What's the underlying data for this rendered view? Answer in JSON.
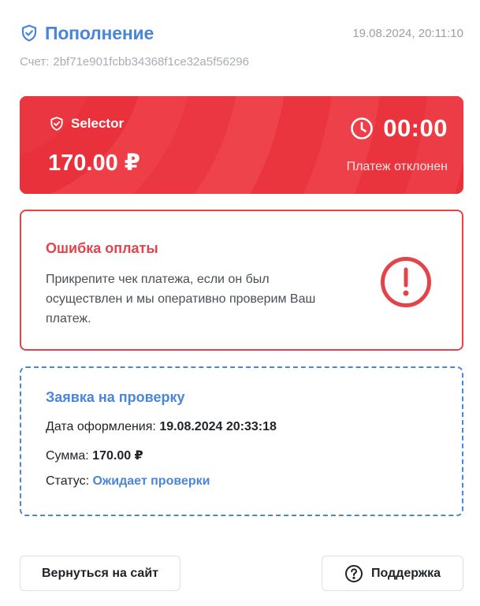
{
  "header": {
    "title": "Пополнение",
    "datetime": "19.08.2024, 20:11:10",
    "account_label": "Счет:",
    "account_id": "2bf71e901fcbb34368f1ce32a5f56296"
  },
  "payment_card": {
    "provider": "Selector",
    "amount": "170.00 ₽",
    "timer": "00:00",
    "status": "Платеж отклонен",
    "accent_color": "#e8303a"
  },
  "error": {
    "title": "Ошибка оплаты",
    "message": "Прикрепите чек платежа, если он был осуществлен и мы оперативно проверим Ваш платеж.",
    "color": "#e5434a",
    "icon": "exclamation-circle-icon"
  },
  "request": {
    "title": "Заявка на проверку",
    "date_label": "Дата оформления:",
    "date_value": "19.08.2024 20:33:18",
    "sum_label": "Сумма:",
    "sum_value": "170.00 ₽",
    "status_label": "Статус:",
    "status_value": "Ожидает проверки",
    "color": "#4a86d8"
  },
  "actions": {
    "back_label": "Вернуться на сайт",
    "support_label": "Поддержка",
    "support_icon": "question-circle-icon"
  }
}
